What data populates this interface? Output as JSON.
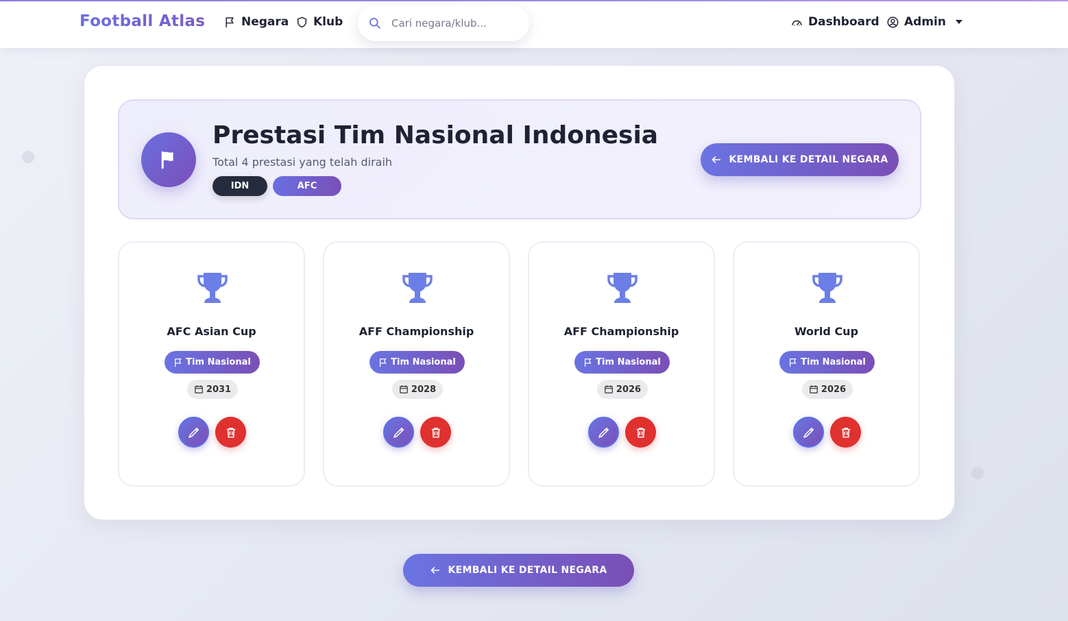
{
  "brand": "Football Atlas",
  "nav": {
    "negara": "Negara",
    "klub": "Klub",
    "search_placeholder": "Cari negara/klub...",
    "dashboard": "Dashboard",
    "admin": "Admin"
  },
  "header": {
    "title": "Prestasi Tim Nasional Indonesia",
    "subtitle": "Total 4 prestasi yang telah diraih",
    "tags": [
      "IDN",
      "AFC"
    ],
    "back_label": "KEMBALI KE DETAIL NEGARA"
  },
  "achievements": [
    {
      "title": "AFC Asian Cup",
      "category": "Tim Nasional",
      "year": "2031"
    },
    {
      "title": "AFF Championship",
      "category": "Tim Nasional",
      "year": "2028"
    },
    {
      "title": "AFF Championship",
      "category": "Tim Nasional",
      "year": "2026"
    },
    {
      "title": "World Cup",
      "category": "Tim Nasional",
      "year": "2026"
    }
  ],
  "footer": {
    "back_label": "KEMBALI KE DETAIL NEGARA"
  },
  "icons": {
    "trophy": "trophy-icon",
    "flag": "flag-icon",
    "calendar": "calendar-icon",
    "edit": "pencil-icon",
    "delete": "trash-icon",
    "search": "search-icon",
    "shield": "shield-icon",
    "dashboard": "speedometer-icon",
    "user": "user-circle-icon",
    "arrow": "arrow-left-icon"
  },
  "colors": {
    "accent": "#6a74e2",
    "accent_dark": "#7a4fb6",
    "danger": "#e0312f",
    "trophy": "#6b7fe6",
    "dark_tag": "#262c3d"
  }
}
